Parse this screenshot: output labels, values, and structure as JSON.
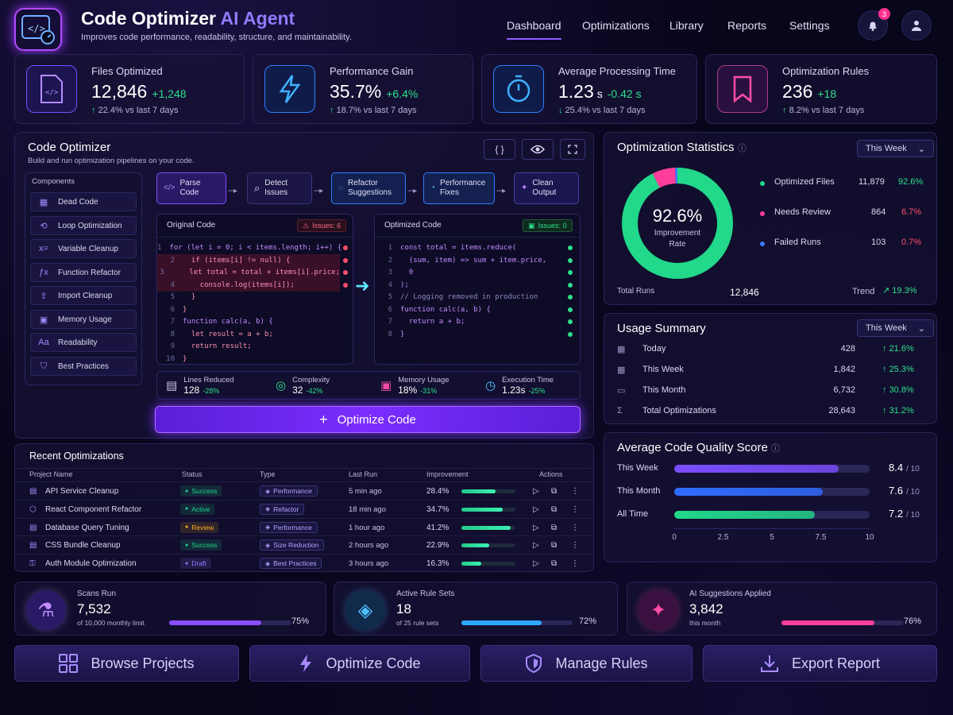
{
  "header": {
    "title": "Code Optimizer",
    "title_accent": "AI Agent",
    "subtitle": "Improves code performance, readability, structure, and maintainability.",
    "nav": [
      "Dashboard",
      "Optimizations",
      "Library",
      "Reports",
      "Settings"
    ],
    "active_nav": "Dashboard",
    "notification_count": "3"
  },
  "stats": [
    {
      "label": "Files Optimized",
      "value": "12,846",
      "unit": "",
      "delta": "+1,248",
      "sub": "22.4% vs last 7 days",
      "arrow": "up",
      "icon": "file-code-icon"
    },
    {
      "label": "Performance Gain",
      "value": "35.7%",
      "unit": "",
      "delta": "+6.4%",
      "sub": "18.7% vs last 7 days",
      "arrow": "up",
      "icon": "lightning-icon"
    },
    {
      "label": "Average Processing Time",
      "value": "1.23",
      "unit": "s",
      "delta": "-0.42 s",
      "sub": "25.4% vs last 7 days",
      "arrow": "down",
      "icon": "stopwatch-icon"
    },
    {
      "label": "Optimization Rules",
      "value": "236",
      "unit": "",
      "delta": "+18",
      "sub": "8.2% vs last 7 days",
      "arrow": "up",
      "icon": "bookmark-icon"
    }
  ],
  "optimizer": {
    "title": "Code Optimizer",
    "subtitle": "Build and run optimization pipelines on your code.",
    "components_label": "Components",
    "components": [
      {
        "label": "Dead Code",
        "icon": "dead-code-icon"
      },
      {
        "label": "Loop Optimization",
        "icon": "loop-icon"
      },
      {
        "label": "Variable Cleanup",
        "icon": "variable-icon"
      },
      {
        "label": "Function Refactor",
        "icon": "function-icon"
      },
      {
        "label": "Import Cleanup",
        "icon": "import-icon"
      },
      {
        "label": "Memory Usage",
        "icon": "chip-icon"
      },
      {
        "label": "Readability",
        "icon": "text-icon"
      },
      {
        "label": "Best Practices",
        "icon": "shield-icon"
      }
    ],
    "pipeline": [
      {
        "label": "Parse Code",
        "icon": "code-icon"
      },
      {
        "label": "Detect Issues",
        "icon": "search-icon"
      },
      {
        "label": "Refactor Suggestions",
        "icon": "lightbulb-icon"
      },
      {
        "label": "Performance Fixes",
        "icon": "gauge-icon"
      },
      {
        "label": "Clean Output",
        "icon": "sparkle-icon"
      }
    ],
    "original": {
      "title": "Original Code",
      "issues": "Issues: 6",
      "lines": [
        "for (let i = 0; i < items.length; i++) {",
        "  if (items[i] != null) {",
        "    let total = total + items[i].price;",
        "    console.log(items[i]);",
        "  }",
        "}",
        "function calc(a, b) {",
        "  let result = a + b;",
        "  return result;",
        "}"
      ]
    },
    "optimized": {
      "title": "Optimized Code",
      "issues": "Issues: 0",
      "lines": [
        "const total = items.reduce(",
        "  (sum, item) => sum + item.price,",
        "  0",
        ");",
        "// Logging removed in production",
        "function calc(a, b) {",
        "  return a + b;",
        "}"
      ]
    },
    "metrics": [
      {
        "label": "Lines Reduced",
        "value": "128",
        "delta": "-28%",
        "icon": "clipboard-icon"
      },
      {
        "label": "Complexity",
        "value": "32",
        "delta": "-42%",
        "icon": "target-icon"
      },
      {
        "label": "Memory Usage",
        "value": "18%",
        "delta": "-31%",
        "icon": "memory-icon"
      },
      {
        "label": "Execution Time",
        "value": "1.23s",
        "delta": "-25%",
        "icon": "clock-icon"
      }
    ],
    "optimize_button": "Optimize Code"
  },
  "statistics": {
    "title": "Optimization Statistics",
    "period": "This Week",
    "donut_value": "92.6%",
    "donut_label": "Improvement Rate",
    "slices": [
      {
        "label": "Optimized Files",
        "value": "11,879",
        "pct": "92.6%",
        "fraction": 0.926,
        "color": "#22d88a"
      },
      {
        "label": "Needs Review",
        "value": "864",
        "pct": "6.7%",
        "fraction": 0.067,
        "color": "#ff3d9a"
      },
      {
        "label": "Failed Runs",
        "value": "103",
        "pct": "0.7%",
        "fraction": 0.007,
        "color": "#3a7bff"
      }
    ],
    "total_label": "Total Runs",
    "total_value": "12,846",
    "trend_label": "Trend",
    "trend_value": "19.3%"
  },
  "usage": {
    "title": "Usage Summary",
    "period": "This Week",
    "rows": [
      {
        "label": "Today",
        "value": "428",
        "delta": "21.6%",
        "icon": "calendar-icon"
      },
      {
        "label": "This Week",
        "value": "1,842",
        "delta": "25.3%",
        "icon": "calendar-icon"
      },
      {
        "label": "This Month",
        "value": "6,732",
        "delta": "30.8%",
        "icon": "folder-icon"
      },
      {
        "label": "Total Optimizations",
        "value": "28,643",
        "delta": "31.2%",
        "icon": "sigma-icon"
      }
    ]
  },
  "quality": {
    "title": "Average Code Quality Score",
    "rows": [
      {
        "label": "This Week",
        "score": "8.4",
        "value": 8.4,
        "color": "#7b4dff"
      },
      {
        "label": "This Month",
        "score": "7.6",
        "value": 7.6,
        "color": "#2f6dff"
      },
      {
        "label": "All Time",
        "score": "7.2",
        "value": 7.2,
        "color": "#22d88a"
      }
    ],
    "max_label": "/ 10",
    "ticks": [
      "0",
      "2.5",
      "5",
      "7.5",
      "10"
    ],
    "xmax": 10
  },
  "recent": {
    "title": "Recent Optimizations",
    "columns": [
      "Project Name",
      "Status",
      "Type",
      "Last Run",
      "Improvement",
      "Actions"
    ],
    "rows": [
      {
        "name": "API Service Cleanup",
        "status": "Success",
        "status_color": "#22d88a",
        "type": "Performance",
        "last_run": "5 min ago",
        "improvement": "28.4%",
        "fraction": 0.284
      },
      {
        "name": "React Component Refactor",
        "status": "Active",
        "status_color": "#22d88a",
        "type": "Refactor",
        "last_run": "18 min ago",
        "improvement": "34.7%",
        "fraction": 0.347
      },
      {
        "name": "Database Query Tuning",
        "status": "Review",
        "status_color": "#ffb020",
        "type": "Performance",
        "last_run": "1 hour ago",
        "improvement": "41.2%",
        "fraction": 0.412
      },
      {
        "name": "CSS Bundle Cleanup",
        "status": "Success",
        "status_color": "#22d88a",
        "type": "Size Reduction",
        "last_run": "2 hours ago",
        "improvement": "22.9%",
        "fraction": 0.229
      },
      {
        "name": "Auth Module Optimization",
        "status": "Draft",
        "status_color": "#8f7bff",
        "type": "Best Practices",
        "last_run": "3 hours ago",
        "improvement": "16.3%",
        "fraction": 0.163
      }
    ]
  },
  "bottom_cards": [
    {
      "label": "Scans Run",
      "value": "7,532",
      "sub": "of 10,000 monthly limit",
      "pct": "75%",
      "fraction": 0.75,
      "color": "#8a4dff",
      "icon": "flask-icon"
    },
    {
      "label": "Active Rule Sets",
      "value": "18",
      "sub": "of 25 rule sets",
      "pct": "72%",
      "fraction": 0.72,
      "color": "#2fa8ff",
      "icon": "layers-icon"
    },
    {
      "label": "AI Suggestions Applied",
      "value": "3,842",
      "sub": "this month",
      "pct": "76%",
      "fraction": 0.76,
      "color": "#ff3d9a",
      "icon": "sparkles-icon"
    }
  ],
  "actions": [
    {
      "label": "Browse Projects",
      "icon": "grid-icon"
    },
    {
      "label": "Optimize Code",
      "icon": "bolt-icon"
    },
    {
      "label": "Manage Rules",
      "icon": "shield-icon"
    },
    {
      "label": "Export Report",
      "icon": "download-icon"
    }
  ]
}
